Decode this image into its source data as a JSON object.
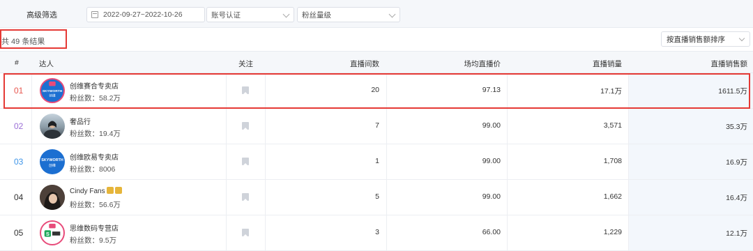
{
  "filters": {
    "label": "高级筛选",
    "date_range": "2022-09-27~2022-10-26",
    "account_placeholder": "账号认证",
    "fans_placeholder": "粉丝量级"
  },
  "results": {
    "count_text": "共 49 条结果",
    "sort_label": "按直播销售额排序"
  },
  "table": {
    "columns": {
      "rank": "#",
      "influencer": "达人",
      "follow": "关注",
      "sessions": "直播间数",
      "avg_price": "场均直播价",
      "sales": "直播销量",
      "amount": "直播销售额"
    },
    "rows": [
      {
        "rank": "01",
        "name": "创维赛合专卖店",
        "fans": "粉丝数：58.2万",
        "sessions": "20",
        "avg_price": "97.13",
        "sales": "17.1万",
        "amount": "1611.5万",
        "rank_color": "#e8574f"
      },
      {
        "rank": "02",
        "name": "奢品行",
        "fans": "粉丝数：19.4万",
        "sessions": "7",
        "avg_price": "99.00",
        "sales": "3,571",
        "amount": "35.3万",
        "rank_color": "#9b6fd6"
      },
      {
        "rank": "03",
        "name": "创维欧易专卖店",
        "fans": "粉丝数：8006",
        "sessions": "1",
        "avg_price": "99.00",
        "sales": "1,708",
        "amount": "16.9万",
        "rank_color": "#3f95e8"
      },
      {
        "rank": "04",
        "name": "Cindy Fans",
        "fans": "粉丝数：56.6万",
        "sessions": "5",
        "avg_price": "99.00",
        "sales": "1,662",
        "amount": "16.4万",
        "rank_color": "#333333"
      },
      {
        "rank": "05",
        "name": "思维数码专营店",
        "fans": "粉丝数：9.5万",
        "sessions": "3",
        "avg_price": "66.00",
        "sales": "1,229",
        "amount": "12.1万",
        "rank_color": "#333333"
      }
    ]
  },
  "logo_text": {
    "skyworth": "SKYWORTH",
    "chuangwei": "创维"
  }
}
